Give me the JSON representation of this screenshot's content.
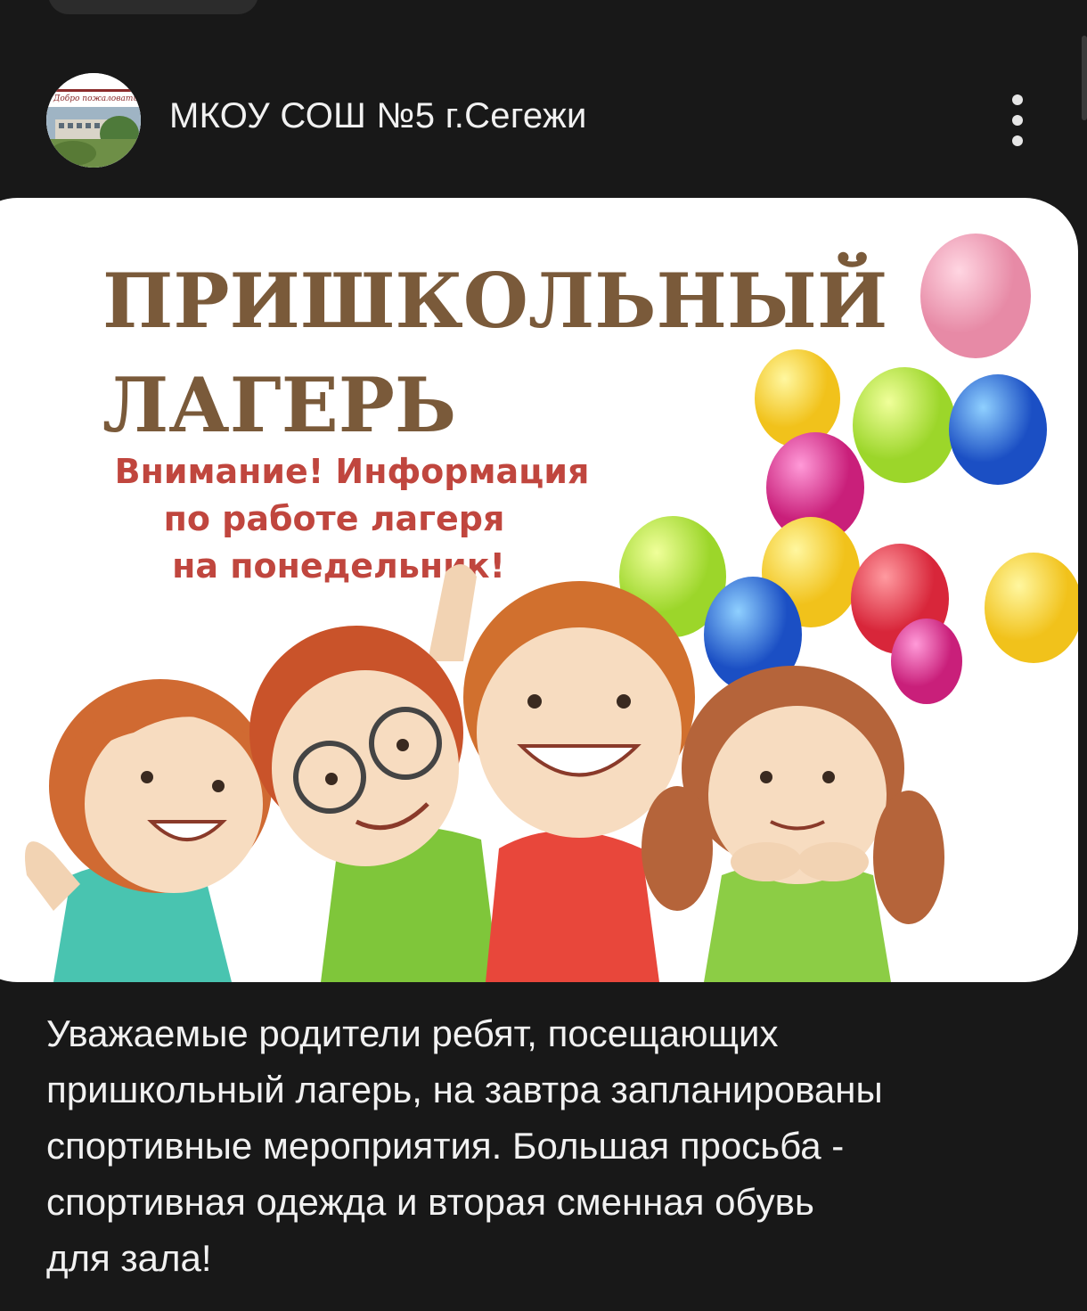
{
  "post": {
    "channel_name": "МКОУ СОШ №5 г.Сегежи",
    "avatar_caption": "Добро пожаловать",
    "more_icon": "vertical-dots-icon",
    "image": {
      "title_line1": "ПРИШКОЛЬНЫЙ",
      "title_line2": "ЛАГЕРЬ",
      "notice_line1": "Внимание! Информация",
      "notice_line2": "по работе лагеря",
      "notice_line3": "на понедельник!"
    },
    "text": "Уважаемые родители ребят, посещающих\nпришкольный лагерь, на завтра запланированы\nспортивные мероприятия. Большая просьба  -\nспортивная одежда  и  вторая  сменная обувь\nдля зала!"
  },
  "colors": {
    "background": "#181818",
    "title_brown": "#7a5a3a",
    "notice_red": "#c0463e"
  }
}
